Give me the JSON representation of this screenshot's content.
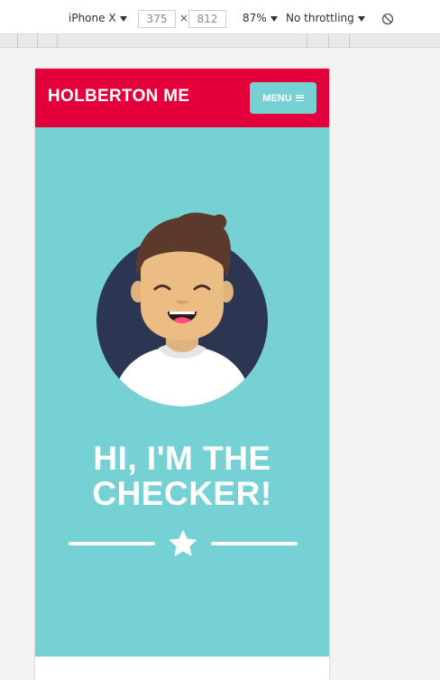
{
  "devtools": {
    "device": "iPhone X",
    "width": "375",
    "height": "812",
    "times": "×",
    "zoom": "87%",
    "throttle": "No throttling",
    "rotate_icon": "rotate-icon"
  },
  "navbar": {
    "brand": "HOLBERTON ME",
    "menu_label": "MENU",
    "menu_icon": "hamburger-icon",
    "color": "#e3003b"
  },
  "hero": {
    "title": "HI, I'M THE CHECKER!",
    "divider_icon": "star-icon",
    "background": "#76d1d5"
  }
}
